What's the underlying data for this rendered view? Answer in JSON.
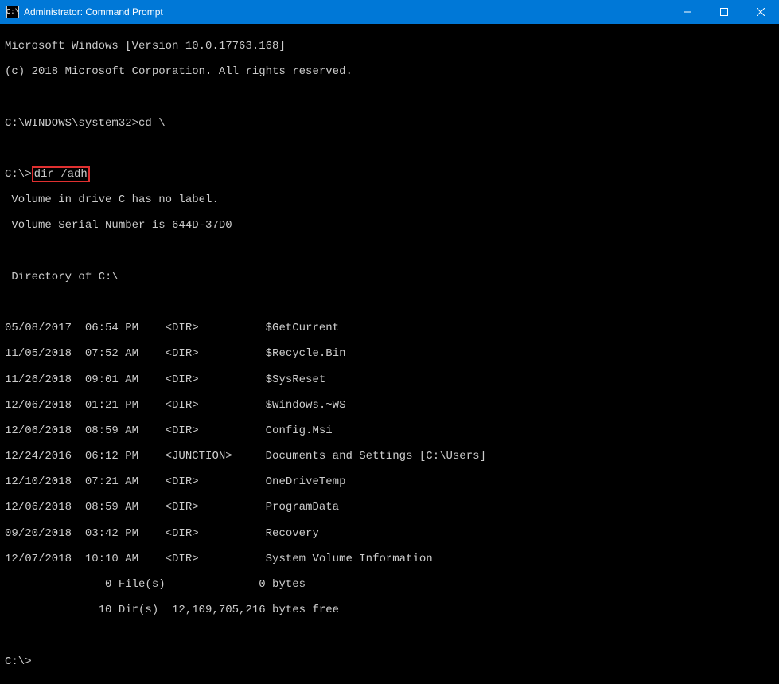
{
  "window": {
    "title": "Administrator: Command Prompt",
    "icon_text": "C:\\"
  },
  "terminal": {
    "version_line": "Microsoft Windows [Version 10.0.17763.168]",
    "copyright_line": "(c) 2018 Microsoft Corporation. All rights reserved.",
    "prompt1_path": "C:\\WINDOWS\\system32>",
    "prompt1_cmd": "cd \\",
    "prompt2_path": "C:\\>",
    "prompt2_cmd": "dir /adh",
    "volume_line": " Volume in drive C has no label.",
    "serial_line": " Volume Serial Number is 644D-37D0",
    "directory_line": " Directory of C:\\",
    "listing": [
      "05/08/2017  06:54 PM    <DIR>          $GetCurrent",
      "11/05/2018  07:52 AM    <DIR>          $Recycle.Bin",
      "11/26/2018  09:01 AM    <DIR>          $SysReset",
      "12/06/2018  01:21 PM    <DIR>          $Windows.~WS",
      "12/06/2018  08:59 AM    <DIR>          Config.Msi",
      "12/24/2016  06:12 PM    <JUNCTION>     Documents and Settings [C:\\Users]",
      "12/10/2018  07:21 AM    <DIR>          OneDriveTemp",
      "12/06/2018  08:59 AM    <DIR>          ProgramData",
      "09/20/2018  03:42 PM    <DIR>          Recovery",
      "12/07/2018  10:10 AM    <DIR>          System Volume Information"
    ],
    "summary_files": "               0 File(s)              0 bytes",
    "summary_dirs": "              10 Dir(s)  12,109,705,216 bytes free",
    "prompt3_path": "C:\\>"
  }
}
